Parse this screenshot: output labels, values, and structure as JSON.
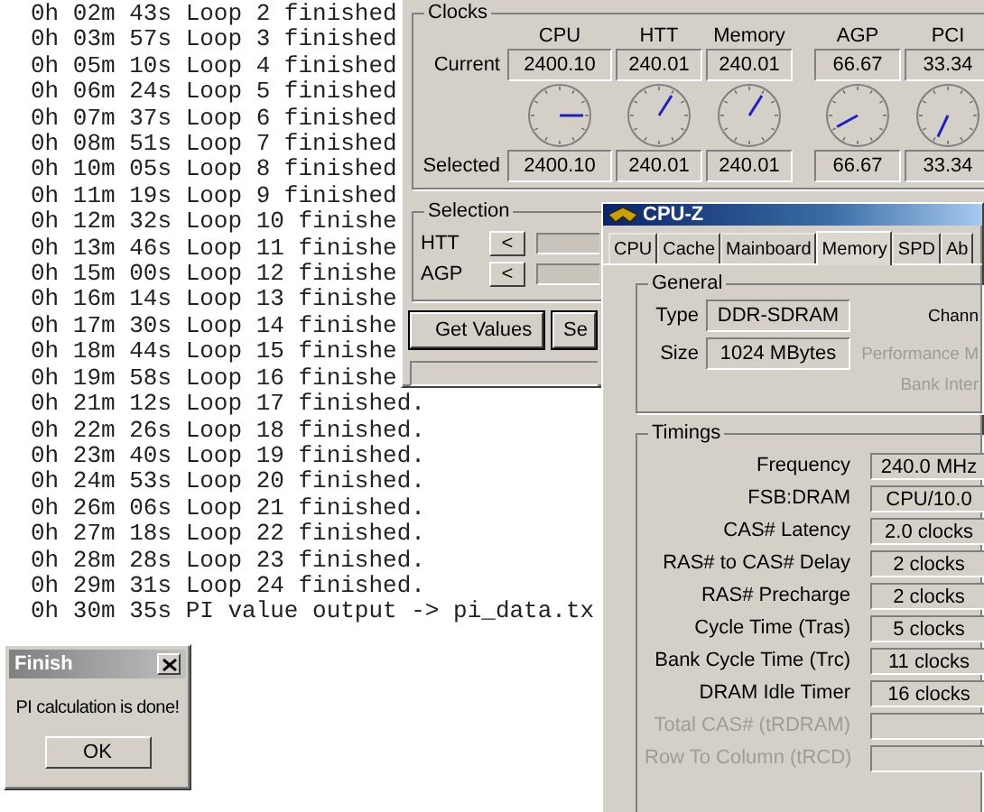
{
  "console": {
    "lines": [
      "0h 02m 43s Loop 2 finished",
      "0h 03m 57s Loop 3 finished",
      "0h 05m 10s Loop 4 finished",
      "0h 06m 24s Loop 5 finished",
      "0h 07m 37s Loop 6 finished",
      "0h 08m 51s Loop 7 finished",
      "0h 10m 05s Loop 8 finished",
      "0h 11m 19s Loop 9 finished",
      "0h 12m 32s Loop 10 finishe",
      "0h 13m 46s Loop 11 finishe",
      "0h 15m 00s Loop 12 finishe",
      "0h 16m 14s Loop 13 finishe",
      "0h 17m 30s Loop 14 finishe",
      "0h 18m 44s Loop 15 finishe",
      "0h 19m 58s Loop 16 finishe",
      "0h 21m 12s Loop 17 finished.",
      "0h 22m 26s Loop 18 finished.",
      "0h 23m 40s Loop 19 finished.",
      "0h 24m 53s Loop 20 finished.",
      "0h 26m 06s Loop 21 finished.",
      "0h 27m 18s Loop 22 finished.",
      "0h 28m 28s Loop 23 finished.",
      "0h 29m 31s Loop 24 finished.",
      "0h 30m 35s PI value output -> pi_data.tx"
    ]
  },
  "clock_tool": {
    "group_title": "Clocks",
    "columns": [
      "CPU",
      "HTT",
      "Memory",
      "AGP",
      "PCI"
    ],
    "rows": [
      {
        "label": "Current",
        "values": [
          "2400.10",
          "240.01",
          "240.01",
          "66.67",
          "33.34"
        ]
      },
      {
        "label": "Selected",
        "values": [
          "2400.10",
          "240.01",
          "240.01",
          "66.67",
          "33.34"
        ]
      }
    ],
    "selection": {
      "title": "Selection",
      "sliders": [
        {
          "label": "HTT",
          "button": "<"
        },
        {
          "label": "AGP",
          "button": "<"
        }
      ]
    },
    "buttons": [
      "Get Values",
      "Se"
    ]
  },
  "cpuz": {
    "title": "CPU-Z",
    "tabs": [
      {
        "label": "CPU",
        "selected": false
      },
      {
        "label": "Cache",
        "selected": false
      },
      {
        "label": "Mainboard",
        "selected": false
      },
      {
        "label": "Memory",
        "selected": true
      },
      {
        "label": "SPD",
        "selected": false
      },
      {
        "label": "Ab",
        "selected": false
      }
    ],
    "general": {
      "title": "General",
      "fields": [
        {
          "label": "Type",
          "value": "DDR-SDRAM"
        },
        {
          "label": "Size",
          "value": "1024 MBytes"
        }
      ],
      "notes": [
        {
          "text": "Chann",
          "disabled": false
        },
        {
          "text": "Performance M",
          "disabled": true
        },
        {
          "text": "Bank Inter",
          "disabled": true
        }
      ]
    },
    "timings": {
      "title": "Timings",
      "rows": [
        {
          "label": "Frequency",
          "value": "240.0 MHz",
          "disabled": false
        },
        {
          "label": "FSB:DRAM",
          "value": "CPU/10.0",
          "disabled": false
        },
        {
          "label": "CAS# Latency",
          "value": "2.0 clocks",
          "disabled": false
        },
        {
          "label": "RAS# to CAS# Delay",
          "value": "2 clocks",
          "disabled": false
        },
        {
          "label": "RAS# Precharge",
          "value": "2 clocks",
          "disabled": false
        },
        {
          "label": "Cycle Time (Tras)",
          "value": "5 clocks",
          "disabled": false
        },
        {
          "label": "Bank Cycle Time (Trc)",
          "value": "11 clocks",
          "disabled": false
        },
        {
          "label": "DRAM Idle Timer",
          "value": "16 clocks",
          "disabled": false
        },
        {
          "label": "Total CAS# (tRDRAM)",
          "disabled": true
        },
        {
          "label": "Row To Column (tRCD)",
          "disabled": true
        }
      ]
    }
  },
  "finish_dialog": {
    "title": "Finish",
    "message": "PI calculation is done!",
    "button": "OK"
  }
}
